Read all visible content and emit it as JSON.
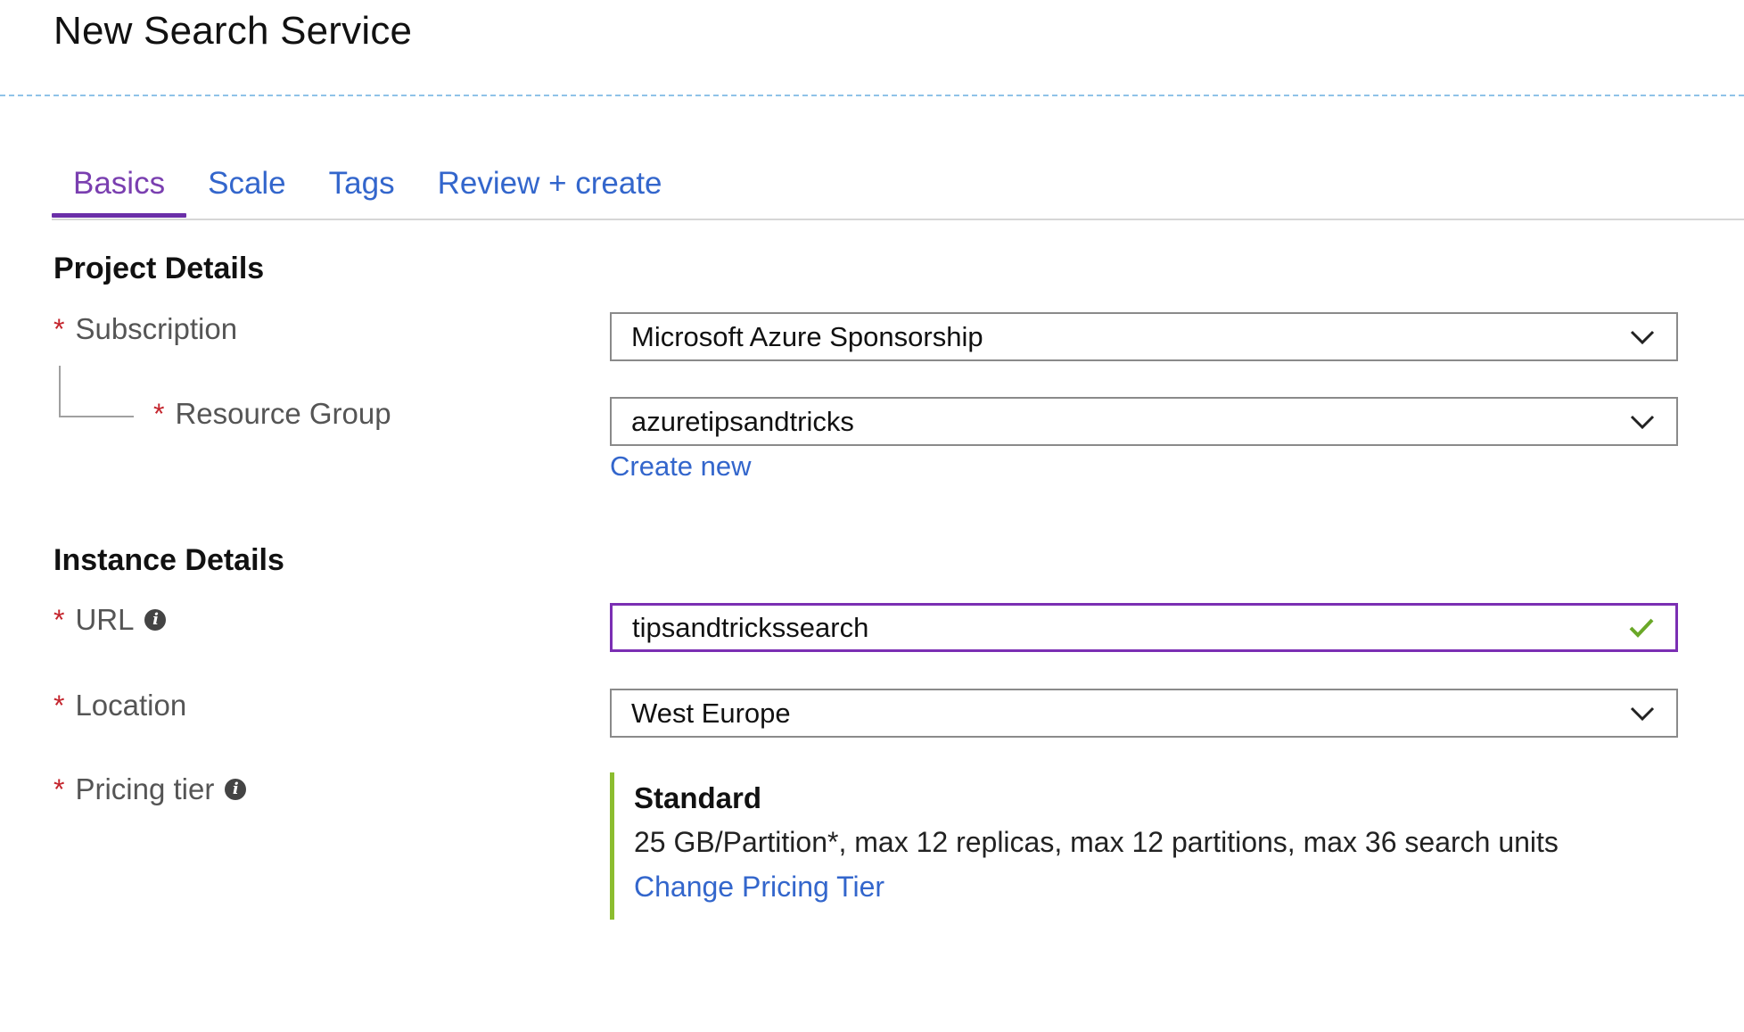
{
  "header": {
    "title": "New Search Service"
  },
  "tabs": [
    {
      "label": "Basics",
      "active": true
    },
    {
      "label": "Scale",
      "active": false
    },
    {
      "label": "Tags",
      "active": false
    },
    {
      "label": "Review + create",
      "active": false
    }
  ],
  "project_details": {
    "title": "Project Details",
    "subscription": {
      "label": "Subscription",
      "required_mark": "*",
      "value": "Microsoft Azure Sponsorship"
    },
    "resource_group": {
      "label": "Resource Group",
      "required_mark": "*",
      "value": "azuretipsandtricks",
      "create_new": "Create new"
    }
  },
  "instance_details": {
    "title": "Instance Details",
    "url": {
      "label": "URL",
      "required_mark": "*",
      "value": "tipsandtrickssearch",
      "valid": true
    },
    "location": {
      "label": "Location",
      "required_mark": "*",
      "value": "West Europe"
    },
    "pricing_tier": {
      "label": "Pricing tier",
      "required_mark": "*",
      "name": "Standard",
      "description": "25 GB/Partition*, max 12 replicas, max 12 partitions, max 36 search units",
      "change_link": "Change Pricing Tier"
    }
  },
  "icons": {
    "info": "info-icon",
    "dropdown": "chevron-down-icon",
    "valid": "checkmark-icon"
  },
  "colors": {
    "link": "#3366cc",
    "active_tab": "#6b2fa8",
    "required": "#c4262e",
    "valid_check": "#6aa828",
    "pricing_accent": "#8cbd2f"
  }
}
